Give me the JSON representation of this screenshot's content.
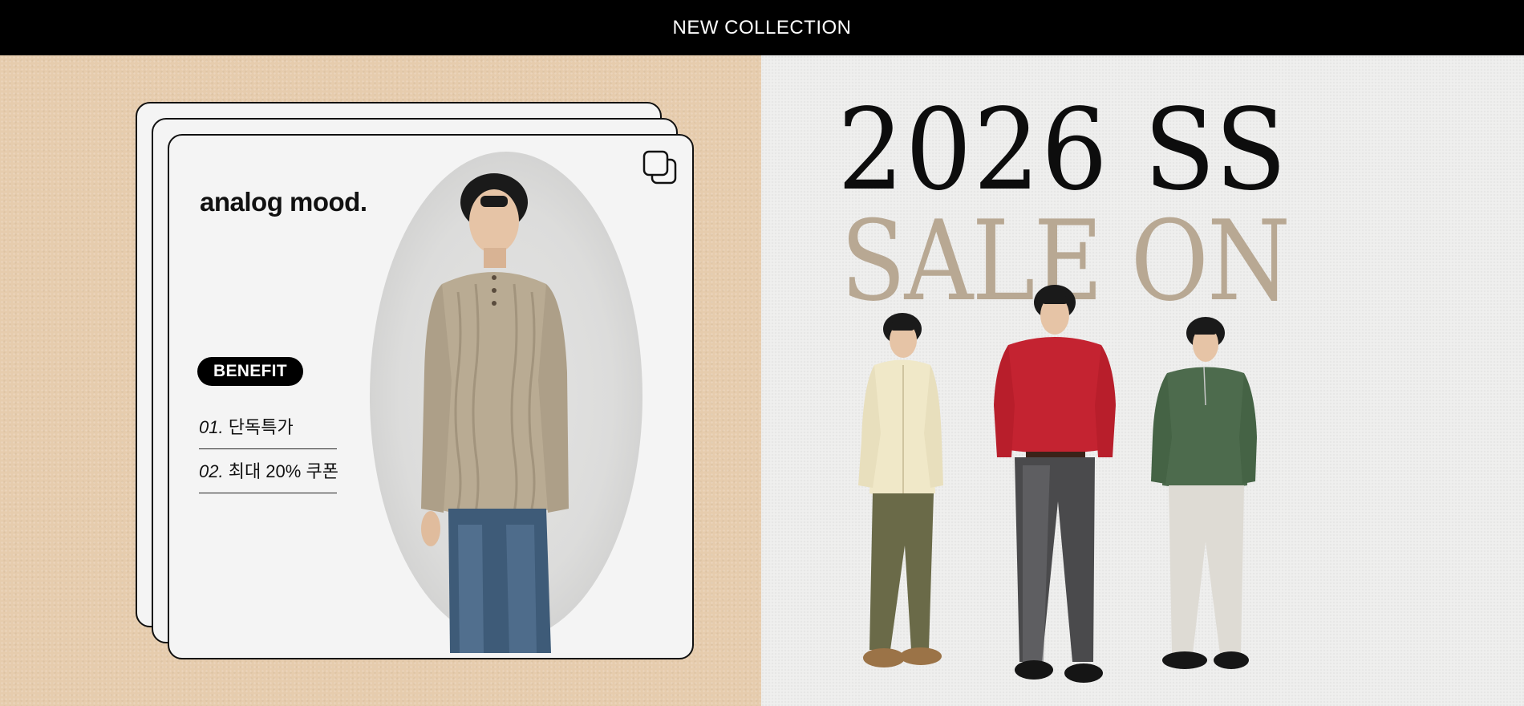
{
  "banner": {
    "title": "NEW COLLECTION"
  },
  "card": {
    "title": "analog mood.",
    "badge": "BENEFIT",
    "benefits": [
      {
        "num": "01.",
        "text": "단독특가"
      },
      {
        "num": "02.",
        "text": "최대 20% 쿠폰"
      }
    ]
  },
  "sale": {
    "line1": "2026 SS",
    "line2": "SALE ON"
  },
  "colors": {
    "left_bg": "#e6ccad",
    "right_bg": "#efefee",
    "sale_accent": "#b8a893",
    "banner_bg": "#000000"
  },
  "icons": [
    "copy-icon"
  ]
}
